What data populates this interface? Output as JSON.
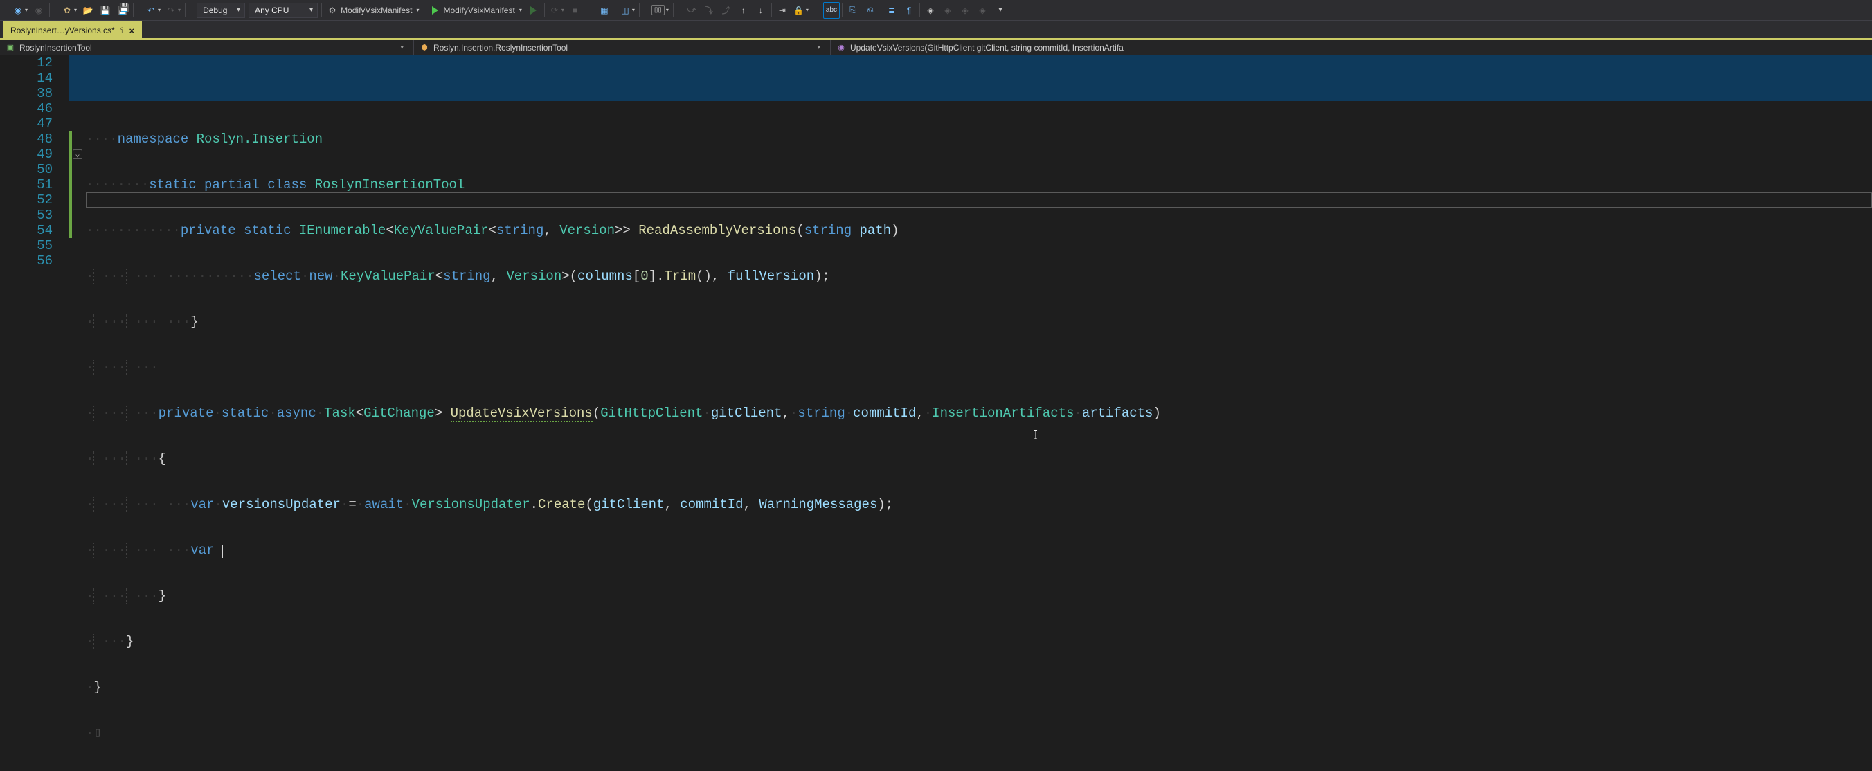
{
  "toolbar": {
    "config": "Debug",
    "platform": "Any CPU",
    "startup1": "ModifyVsixManifest",
    "startup2": "ModifyVsixManifest"
  },
  "tab": {
    "title": "RoslynInsert…yVersions.cs*"
  },
  "breadcrumb": {
    "project": "RoslynInsertionTool",
    "type": "Roslyn.Insertion.RoslynInsertionTool",
    "member": "UpdateVsixVersions(GitHttpClient gitClient, string commitId, InsertionArtifa"
  },
  "lines": [
    {
      "num": 12
    },
    {
      "num": 14
    },
    {
      "num": 38
    },
    {
      "num": 46
    },
    {
      "num": 47
    },
    {
      "num": 48
    },
    {
      "num": 49
    },
    {
      "num": 50
    },
    {
      "num": 51
    },
    {
      "num": 52
    },
    {
      "num": 53
    },
    {
      "num": 54
    },
    {
      "num": 55
    },
    {
      "num": 56
    }
  ],
  "code": {
    "l12": {
      "namespace": "namespace",
      "ns": "Roslyn.Insertion"
    },
    "l14": {
      "static": "static",
      "partial": "partial",
      "class": "class",
      "name": "RoslynInsertionTool"
    },
    "l38": {
      "private": "private",
      "static": "static",
      "ret": "IEnumerable",
      "kvp": "KeyValuePair",
      "string": "string",
      "ver": "Version",
      "fn": "ReadAssemblyVersions",
      "p1t": "string",
      "p1n": "path"
    },
    "l46": {
      "select": "select",
      "new": "new",
      "kvp": "KeyValuePair",
      "string": "string",
      "ver": "Version",
      "columns": "columns",
      "zero": "0",
      "trim": "Trim",
      "fullVersion": "fullVersion"
    },
    "l47": {
      "brace": "}"
    },
    "l49": {
      "private": "private",
      "static": "static",
      "async": "async",
      "task": "Task",
      "gc": "GitChange",
      "fn": "UpdateVsixVersions",
      "p1t": "GitHttpClient",
      "p1n": "gitClient",
      "p2t": "string",
      "p2n": "commitId",
      "p3t": "InsertionArtifacts",
      "p3n": "artifacts"
    },
    "l50": {
      "brace": "{"
    },
    "l51": {
      "var": "var",
      "v": "versionsUpdater",
      "await": "await",
      "cls": "VersionsUpdater",
      "m": "Create",
      "a1": "gitClient",
      "a2": "commitId",
      "a3": "WarningMessages"
    },
    "l52": {
      "var": "var"
    },
    "l53": {
      "brace": "}"
    },
    "l54": {
      "brace": "}"
    },
    "l55": {
      "brace": "}"
    }
  }
}
